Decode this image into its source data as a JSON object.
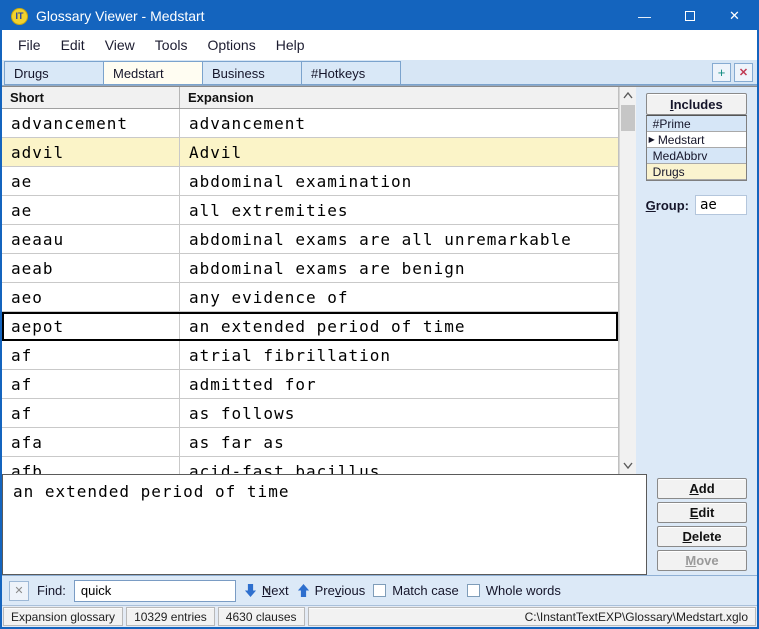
{
  "window": {
    "title": "Glossary Viewer - Medstart",
    "icon_text": "IT",
    "controls": {
      "minimize": "—",
      "close": "✕"
    }
  },
  "menu": {
    "items": [
      "File",
      "Edit",
      "View",
      "Tools",
      "Options",
      "Help"
    ]
  },
  "tabs": {
    "items": [
      {
        "label": "Drugs",
        "active": false
      },
      {
        "label": "Medstart",
        "active": true
      },
      {
        "label": "Business",
        "active": false
      },
      {
        "label": "#Hotkeys",
        "active": false
      }
    ],
    "add_label": "+",
    "close_label": "✕"
  },
  "glossary_table": {
    "columns": [
      "Short",
      "Expansion"
    ],
    "rows": [
      {
        "short": "advancement",
        "expansion": "advancement",
        "state": ""
      },
      {
        "short": "advil",
        "expansion": "Advil",
        "state": "highlighted"
      },
      {
        "short": "ae",
        "expansion": "abdominal examination",
        "state": ""
      },
      {
        "short": "ae",
        "expansion": "all extremities",
        "state": ""
      },
      {
        "short": "aeaau",
        "expansion": "abdominal exams are all unremarkable",
        "state": ""
      },
      {
        "short": "aeab",
        "expansion": "abdominal exams are benign",
        "state": ""
      },
      {
        "short": "aeo",
        "expansion": "any evidence of",
        "state": ""
      },
      {
        "short": "aepot",
        "expansion": "an extended period of time",
        "state": "selected"
      },
      {
        "short": "af",
        "expansion": "atrial fibrillation",
        "state": ""
      },
      {
        "short": "af",
        "expansion": "admitted for",
        "state": ""
      },
      {
        "short": "af",
        "expansion": "as follows",
        "state": ""
      },
      {
        "short": "afa",
        "expansion": "as far as",
        "state": ""
      },
      {
        "short": "afb",
        "expansion": "acid-fast bacillus",
        "state": ""
      }
    ]
  },
  "includes_panel": {
    "header": "Includes",
    "items": [
      {
        "label": "#Prime",
        "tone": "blue",
        "current": false
      },
      {
        "label": "Medstart",
        "tone": "white",
        "current": true
      },
      {
        "label": "MedAbbrv",
        "tone": "blue",
        "current": false
      },
      {
        "label": "Drugs",
        "tone": "yellow",
        "current": false
      }
    ],
    "group_label": "Group:",
    "group_value": "ae"
  },
  "actions": {
    "add": "Add",
    "edit": "Edit",
    "delete": "Delete",
    "move": "Move"
  },
  "preview": {
    "text": "an extended period of time"
  },
  "find_bar": {
    "label": "Find:",
    "value": "quick",
    "next": "Next",
    "previous": "Previous",
    "match_case": "Match case",
    "whole_words": "Whole words"
  },
  "status_bar": {
    "glossary_type": "Expansion glossary",
    "entries": "10329 entries",
    "clauses": "4630 clauses",
    "file_path": "C:\\InstantTextEXP\\Glossary\\Medstart.xglo"
  },
  "colors": {
    "titlebar": "#1464be",
    "panel_blue": "#dce9f7",
    "include_blue": "#d6e6f7",
    "include_yellow": "#faf3cf",
    "highlight_row": "#fbf4c8",
    "accent_blue": "#2e6fce"
  }
}
